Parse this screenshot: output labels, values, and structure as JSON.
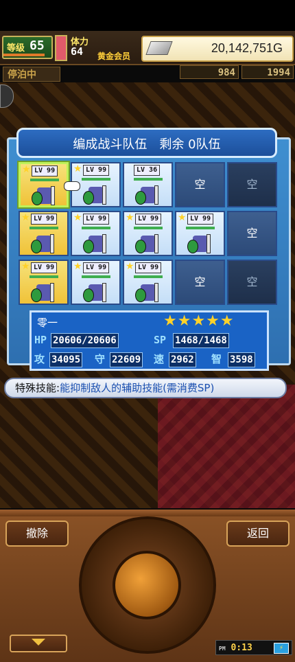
{
  "header": {
    "level_label": "等级",
    "level_value": "65",
    "stamina_label": "体力",
    "stamina_value": "64",
    "membership": "黄金会员",
    "money": "20,142,751G",
    "status": "停泊中",
    "bag_count": "984",
    "medal_count": "1994"
  },
  "panel": {
    "title": "编成战斗队伍　剩余 0队伍",
    "empty_label": "空",
    "rows": [
      [
        {
          "filled": true,
          "level": "99",
          "star": true,
          "selected": true
        },
        {
          "filled": true,
          "level": "99",
          "star": true
        },
        {
          "filled": true,
          "level": "36",
          "star": false
        },
        {
          "filled": false
        },
        {
          "filled": false,
          "dim": true
        }
      ],
      [
        {
          "filled": true,
          "level": "99",
          "star": true,
          "yellow": true
        },
        {
          "filled": true,
          "level": "99",
          "star": true
        },
        {
          "filled": true,
          "level": "99",
          "star": true
        },
        {
          "filled": true,
          "level": "99",
          "star": true
        },
        {
          "filled": false
        }
      ],
      [
        {
          "filled": true,
          "level": "99",
          "star": true,
          "yellow": true
        },
        {
          "filled": true,
          "level": "99",
          "star": true
        },
        {
          "filled": true,
          "level": "99",
          "star": true
        },
        {
          "filled": false
        },
        {
          "filled": false,
          "dim": true
        }
      ]
    ]
  },
  "info": {
    "name": "零一",
    "stars": "★★★★★",
    "hp_label": "HP",
    "hp_value": "20606/20606",
    "sp_label": "SP",
    "sp_value": "1468/1468",
    "atk_label": "攻",
    "atk_value": "34095",
    "def_label": "守",
    "def_value": "22609",
    "spd_label": "速",
    "spd_value": "2962",
    "int_label": "智",
    "int_value": "3598"
  },
  "skill": {
    "label": "特殊技能:",
    "description": "能抑制敌人的辅助技能(需消费SP)"
  },
  "controls": {
    "remove_label": "撤除",
    "back_label": "返回",
    "time_period": "PM",
    "time": "0:13"
  }
}
